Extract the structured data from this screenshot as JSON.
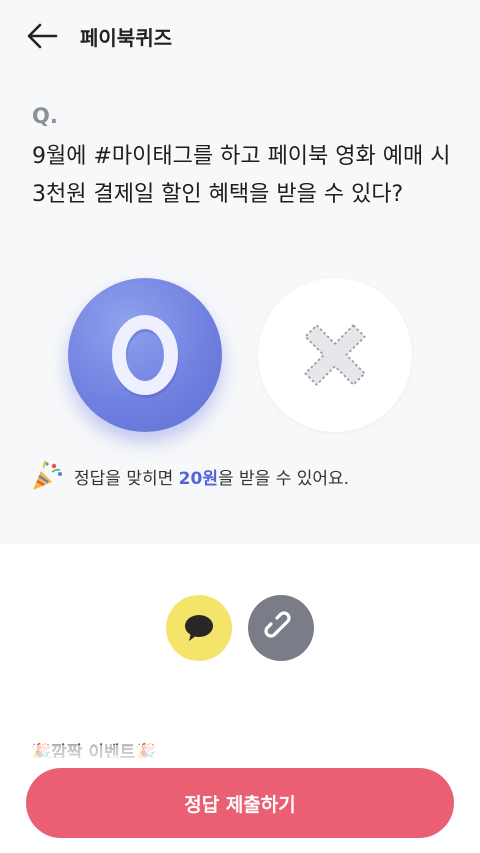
{
  "header": {
    "back_icon": "arrow-left-icon",
    "title": "페이북퀴즈"
  },
  "quiz": {
    "q_label": "Q.",
    "question": "9월에 #마이태그를 하고 페이북 영화 예매 시 3천원 결제일 할인 혜택을 받을 수 있다?",
    "options": [
      {
        "id": "o",
        "label": "O",
        "selected": true,
        "color": "#7181e0"
      },
      {
        "id": "x",
        "label": "X",
        "selected": false,
        "color": "#ffffff"
      }
    ]
  },
  "reward": {
    "icon": "party-popper-icon",
    "text_before": "정답을 맞히면 ",
    "amount": "20원",
    "text_after": "을 받을 수 있어요.",
    "accent_color": "#5563d8"
  },
  "share": {
    "kakao_icon": "speech-bubble-icon",
    "kakao_color": "#f4e46a",
    "link_icon": "link-icon",
    "link_color": "#7a7c87"
  },
  "event_section": {
    "title": "🎉깜짝 이벤트🎉"
  },
  "submit": {
    "label": "정답 제출하기",
    "color": "#eb5f73"
  }
}
